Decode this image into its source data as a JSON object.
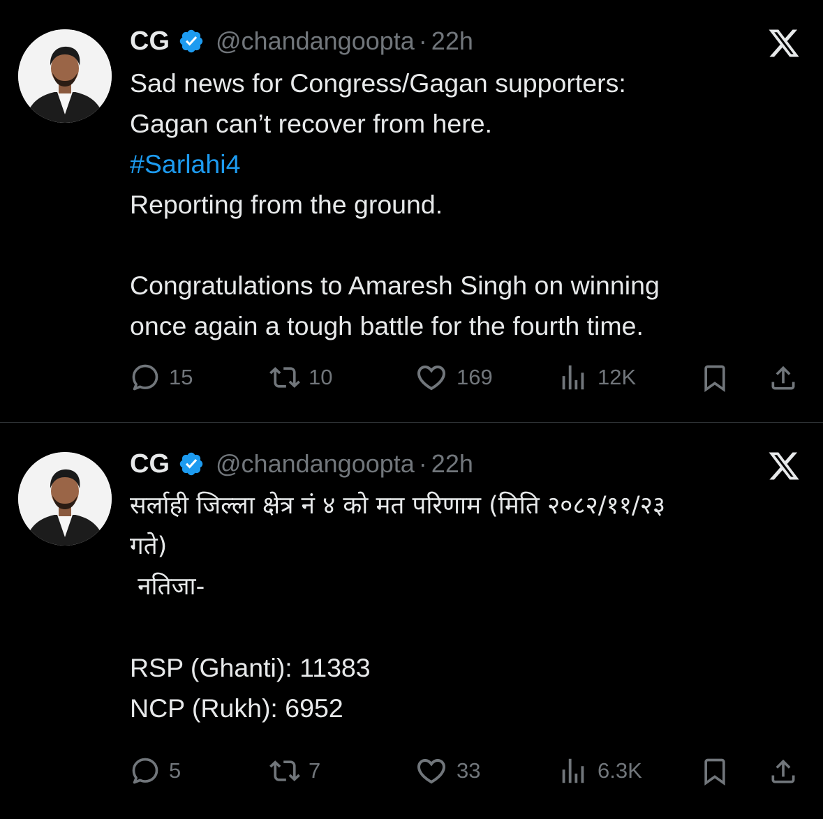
{
  "colors": {
    "background": "#000000",
    "text": "#e7e9ea",
    "secondary": "#71767b",
    "hashtag": "#1d9bf0",
    "verified": "#1d9bf0",
    "divider": "#2f3336"
  },
  "tweets": [
    {
      "display_name": "CG",
      "handle": "@chandangoopta",
      "separator": "·",
      "time": "22h",
      "icons": [
        "avatar-photo",
        "verified-badge-icon",
        "x-logo-icon"
      ],
      "body": {
        "line1": "Sad news for Congress/Gagan supporters:",
        "line2": "Gagan can’t recover from here.",
        "hashtag": "#Sarlahi4",
        "line4": "Reporting from the ground.",
        "line5": "Congratulations to Amaresh Singh on winning",
        "line6": "once again a tough battle for the fourth time."
      },
      "stats": {
        "replies": "15",
        "reposts": "10",
        "likes": "169",
        "views": "12K"
      },
      "action_icons": [
        "reply-icon",
        "repost-icon",
        "like-icon",
        "views-icon",
        "bookmark-icon",
        "share-icon"
      ]
    },
    {
      "display_name": "CG",
      "handle": "@chandangoopta",
      "separator": "·",
      "time": "22h",
      "icons": [
        "avatar-photo",
        "verified-badge-icon",
        "x-logo-icon"
      ],
      "body": {
        "line1": "सर्लाही जिल्ला क्षेत्र नं ४ को मत परिणाम (मिति २०८२/११/२३",
        "line2": "गते)",
        "line3": " नतिजा-",
        "line4": "RSP (Ghanti): 11383",
        "line5": "NCP (Rukh): 6952"
      },
      "stats": {
        "replies": "5",
        "reposts": "7",
        "likes": "33",
        "views": "6.3K"
      },
      "action_icons": [
        "reply-icon",
        "repost-icon",
        "like-icon",
        "views-icon",
        "bookmark-icon",
        "share-icon"
      ]
    }
  ]
}
